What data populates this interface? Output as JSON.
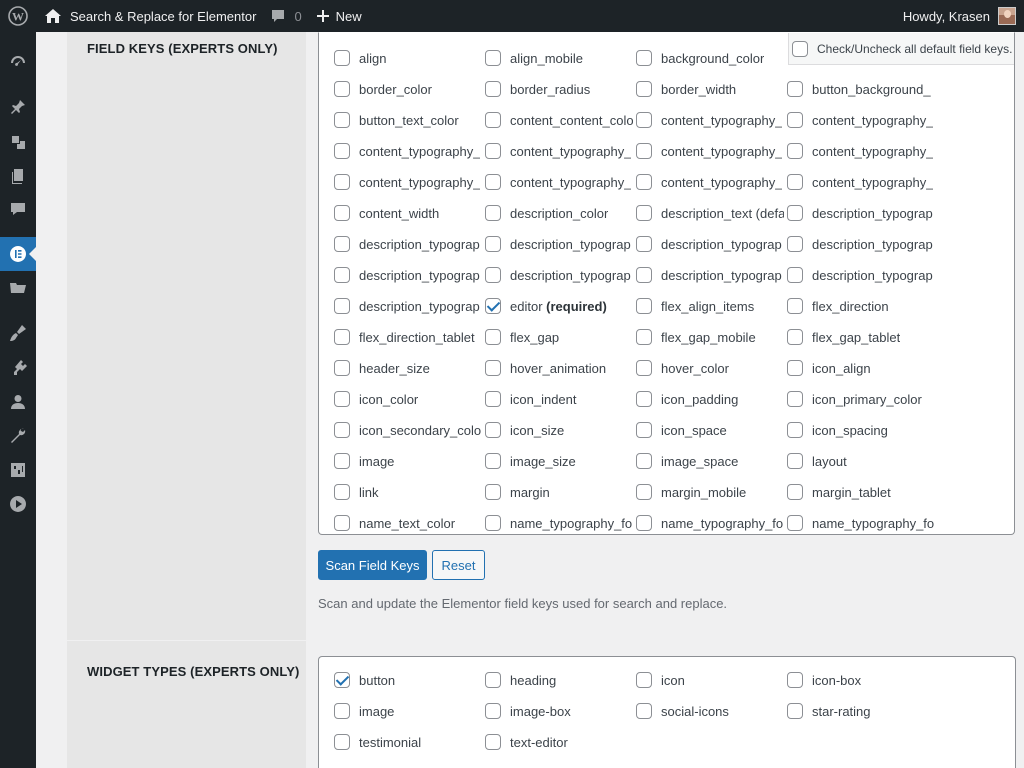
{
  "adminbar": {
    "site_name": "Search & Replace for Elementor",
    "comments_count": "0",
    "new_label": "New",
    "greeting": "Howdy, Krasen"
  },
  "menu_icons": [
    "dashboard-icon",
    "posts-icon",
    "media-icon",
    "pages-icon",
    "comments-icon",
    "elementor-icon",
    "templates-icon",
    "appearance-icon",
    "plugins-icon",
    "users-icon",
    "tools-icon",
    "settings-icon",
    "media-player-icon"
  ],
  "field_keys": {
    "section_label": "FIELD KEYS (EXPERTS ONLY)",
    "check_all_label": "Check/Uncheck all default field keys.",
    "items": [
      [
        "align",
        "align_mobile",
        "background_color"
      ],
      [
        "border_color",
        "border_radius",
        "border_width",
        "button_background_"
      ],
      [
        "button_text_color",
        "content_content_colo",
        "content_typography_",
        "content_typography_"
      ],
      [
        "content_typography_",
        "content_typography_",
        "content_typography_",
        "content_typography_"
      ],
      [
        "content_typography_",
        "content_typography_",
        "content_typography_",
        "content_typography_"
      ],
      [
        "content_width",
        "description_color",
        "description_text (defa",
        "description_typograp"
      ],
      [
        "description_typograp",
        "description_typograp",
        "description_typograp",
        "description_typograp"
      ],
      [
        "description_typograp",
        "description_typograp",
        "description_typograp",
        "description_typograp"
      ],
      [
        "description_typograp",
        "editor (required)",
        "flex_align_items",
        "flex_direction"
      ],
      [
        "flex_direction_tablet",
        "flex_gap",
        "flex_gap_mobile",
        "flex_gap_tablet"
      ],
      [
        "header_size",
        "hover_animation",
        "hover_color",
        "icon_align"
      ],
      [
        "icon_color",
        "icon_indent",
        "icon_padding",
        "icon_primary_color"
      ],
      [
        "icon_secondary_color",
        "icon_size",
        "icon_space",
        "icon_spacing"
      ],
      [
        "image",
        "image_size",
        "image_space",
        "layout"
      ],
      [
        "link",
        "margin",
        "margin_mobile",
        "margin_tablet"
      ],
      [
        "name_text_color",
        "name_typography_fo",
        "name_typography_fo",
        "name_typography_fo"
      ]
    ],
    "checked": [
      "editor (required)"
    ]
  },
  "buttons": {
    "scan_label": "Scan Field Keys",
    "reset_label": "Reset"
  },
  "description": "Scan and update the Elementor field keys used for search and replace.",
  "widget_types": {
    "section_label": "WIDGET TYPES (EXPERTS ONLY)",
    "items": [
      [
        "button",
        "heading",
        "icon",
        "icon-box"
      ],
      [
        "image",
        "image-box",
        "social-icons",
        "star-rating"
      ],
      [
        "testimonial",
        "text-editor"
      ]
    ],
    "checked": [
      "button"
    ]
  }
}
